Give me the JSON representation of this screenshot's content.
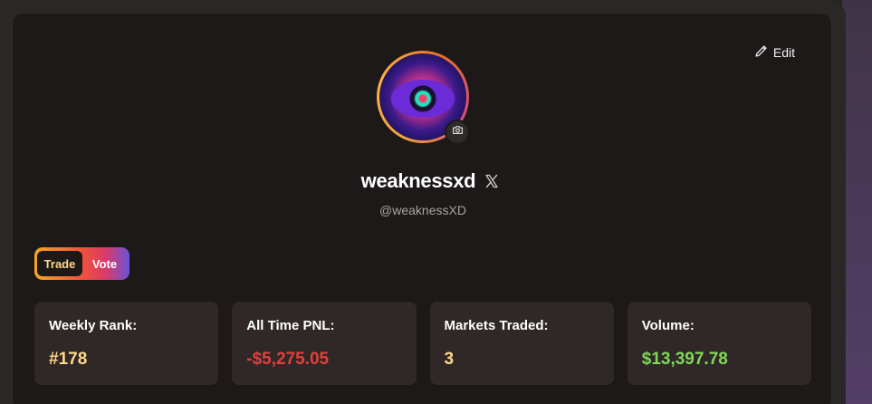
{
  "profile": {
    "edit_label": "Edit",
    "username": "weaknessxd",
    "handle": "@weaknessXD"
  },
  "toggle": {
    "trade_label": "Trade",
    "vote_label": "Vote",
    "selected": "Trade"
  },
  "stats": [
    {
      "label": "Weekly Rank:",
      "value": "#178",
      "color": "#ffd78a"
    },
    {
      "label": "All Time PNL:",
      "value": "-$5,275.05",
      "color": "#e0403a"
    },
    {
      "label": "Markets Traded:",
      "value": "3",
      "color": "#ffd78a"
    },
    {
      "label": "Volume:",
      "value": "$13,397.78",
      "color": "#7ed957"
    }
  ],
  "icons": {
    "edit": "pencil-icon",
    "camera": "camera-icon",
    "social": "x-logo-icon"
  },
  "colors": {
    "card_bg": "#1c1918",
    "stat_bg": "#2f2827",
    "accent_gold": "#ffd78a",
    "negative": "#e0403a",
    "positive": "#7ed957"
  }
}
